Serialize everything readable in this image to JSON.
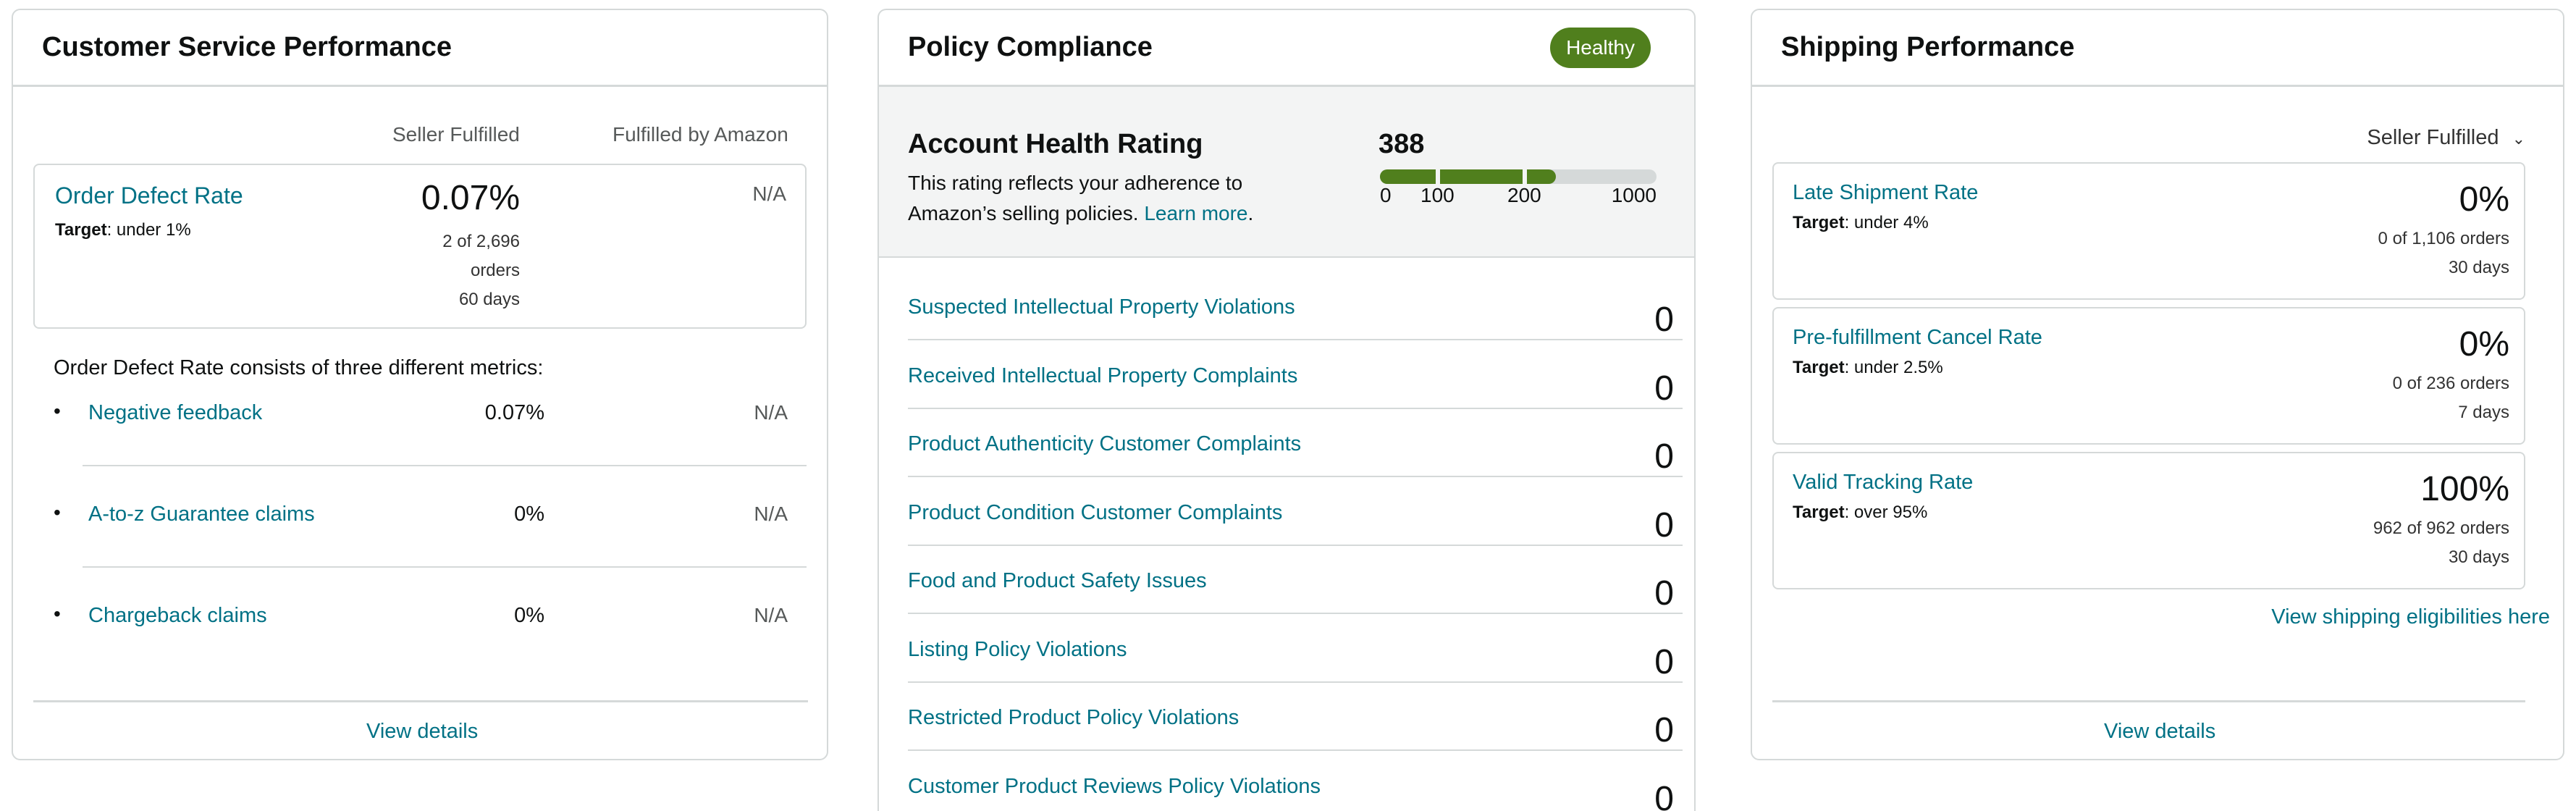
{
  "customer_service": {
    "title": "Customer Service Performance",
    "col_seller": "Seller Fulfilled",
    "col_fba": "Fulfilled by Amazon",
    "odr": {
      "label": "Order Defect Rate",
      "target_label": "Target",
      "target_value": ": under 1%",
      "value": "0.07%",
      "count": "2 of 2,696",
      "unit": "orders",
      "period": "60 days",
      "fba_value": "N/A"
    },
    "consists_text": "Order Defect Rate consists of three different metrics:",
    "metrics": [
      {
        "label": "Negative feedback",
        "value": "0.07%",
        "fba": "N/A"
      },
      {
        "label": "A-to-z Guarantee claims",
        "value": "0%",
        "fba": "N/A"
      },
      {
        "label": "Chargeback claims",
        "value": "0%",
        "fba": "N/A"
      }
    ],
    "view_details": "View details"
  },
  "policy_compliance": {
    "title": "Policy Compliance",
    "status_badge": "Healthy",
    "ahr": {
      "title": "Account Health Rating",
      "desc_line1": "This rating reflects your adherence to",
      "desc_line2": "Amazon’s selling policies.",
      "learn_more": "Learn more",
      "period_char": ".",
      "score": "388",
      "score_value": 388,
      "scale_max": 1000,
      "ticks": [
        "0",
        "100",
        "200",
        "1000"
      ],
      "colors": {
        "good": "#507f1d",
        "empty": "#d5d9d9"
      }
    },
    "rows": [
      {
        "label": "Suspected Intellectual Property Violations",
        "value": "0"
      },
      {
        "label": "Received Intellectual Property Complaints",
        "value": "0"
      },
      {
        "label": "Product Authenticity Customer Complaints",
        "value": "0"
      },
      {
        "label": "Product Condition Customer Complaints",
        "value": "0"
      },
      {
        "label": "Food and Product Safety Issues",
        "value": "0"
      },
      {
        "label": "Listing Policy Violations",
        "value": "0"
      },
      {
        "label": "Restricted Product Policy Violations",
        "value": "0"
      },
      {
        "label": "Customer Product Reviews Policy Violations",
        "value": "0"
      }
    ]
  },
  "shipping": {
    "title": "Shipping Performance",
    "fulfillment_select": "Seller Fulfilled",
    "metrics": [
      {
        "label": "Late Shipment Rate",
        "target_label": "Target",
        "target_value": ": under 4%",
        "value": "0%",
        "count": "0 of 1,106 orders",
        "period": "30 days"
      },
      {
        "label": "Pre-fulfillment Cancel Rate",
        "target_label": "Target",
        "target_value": ": under 2.5%",
        "value": "0%",
        "count": "0 of 236 orders",
        "period": "7 days"
      },
      {
        "label": "Valid Tracking Rate",
        "target_label": "Target",
        "target_value": ": over 95%",
        "value": "100%",
        "count": "962 of 962 orders",
        "period": "30 days"
      }
    ],
    "eligibilities_link": "View shipping eligibilities here",
    "view_details": "View details"
  }
}
